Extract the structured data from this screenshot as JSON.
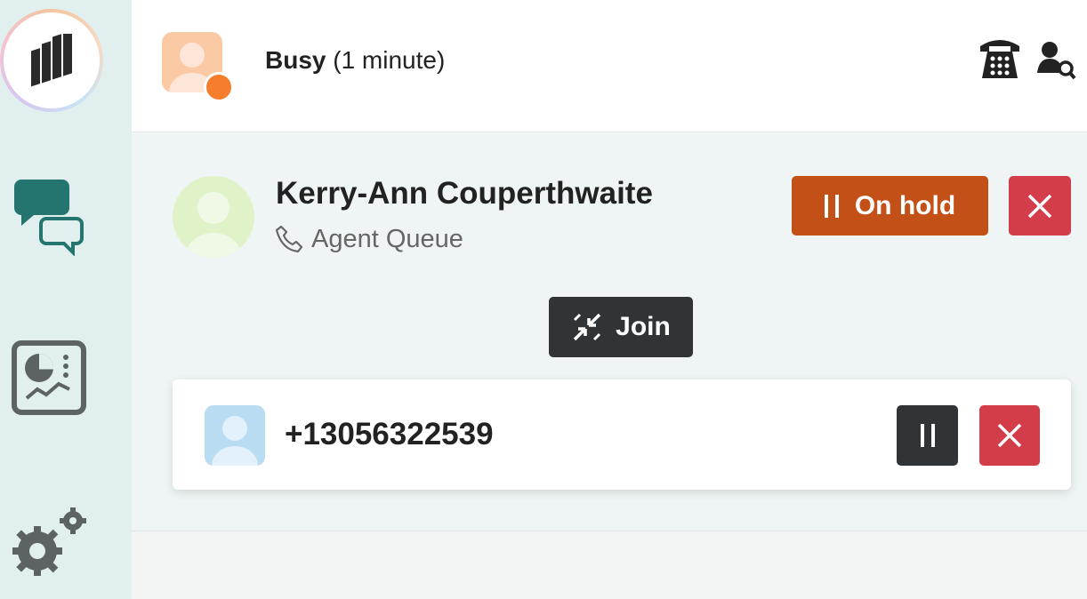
{
  "sidebar": {
    "items": [
      {
        "name": "app-logo"
      },
      {
        "name": "chat-icon"
      },
      {
        "name": "dashboard-icon"
      },
      {
        "name": "settings-icon"
      }
    ]
  },
  "header": {
    "status_label": "Busy",
    "status_duration": "(1 minute)",
    "status_color": "#f57d2c"
  },
  "active_call": {
    "caller_name": "Kerry-Ann Couperthwaite",
    "queue_label": "Agent Queue",
    "hold_label": "On hold",
    "hold_color": "#c35016",
    "hangup_color": "#d23d49"
  },
  "join": {
    "label": "Join"
  },
  "secondary_call": {
    "number": "+13056322539"
  }
}
